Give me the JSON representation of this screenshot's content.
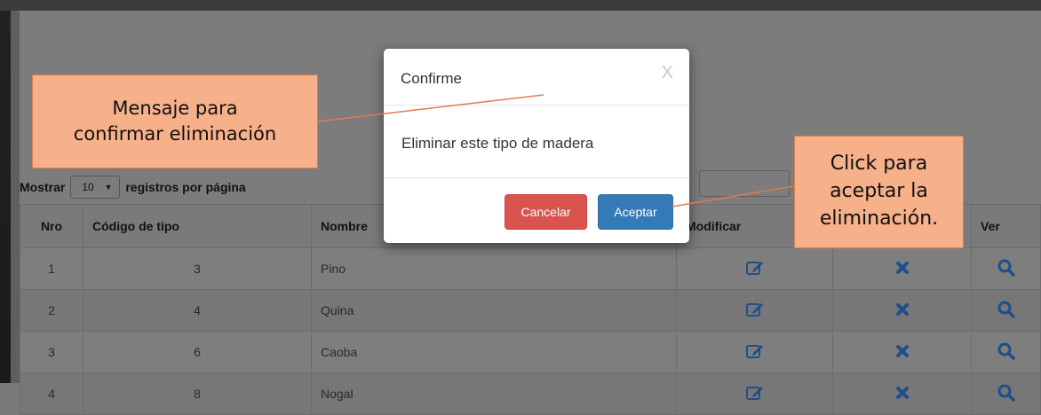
{
  "table_controls": {
    "show_label": "Mostrar",
    "page_size": "10",
    "dropdown_caret": "▼",
    "per_page_label": "registros por página"
  },
  "table": {
    "headers": [
      "Nro",
      "Código de tipo",
      "Nombre",
      "Modificar",
      "",
      "Ver"
    ],
    "rows": [
      {
        "nro": "1",
        "codigo": "3",
        "nombre": "Pino"
      },
      {
        "nro": "2",
        "codigo": "4",
        "nombre": "Quina"
      },
      {
        "nro": "3",
        "codigo": "6",
        "nombre": "Caoba"
      },
      {
        "nro": "4",
        "codigo": "8",
        "nombre": "Nogal"
      }
    ],
    "icons": {
      "edit": "edit-icon",
      "delete": "delete-icon",
      "view": "search-icon"
    }
  },
  "modal": {
    "title": "Confirme",
    "close_label": "X",
    "message": "Eliminar este tipo de madera",
    "cancel_label": "Cancelar",
    "accept_label": "Aceptar"
  },
  "annotations": {
    "left": [
      "Mensaje para",
      "confirmar eliminación"
    ],
    "right": [
      "Click para",
      "aceptar la",
      "eliminación."
    ]
  },
  "colors": {
    "cancel": "#d9534f",
    "accept": "#337ab7",
    "callout_fill": "#f6b08a",
    "callout_border": "#e07b4f",
    "icon_blue": "#1e4f8a"
  }
}
